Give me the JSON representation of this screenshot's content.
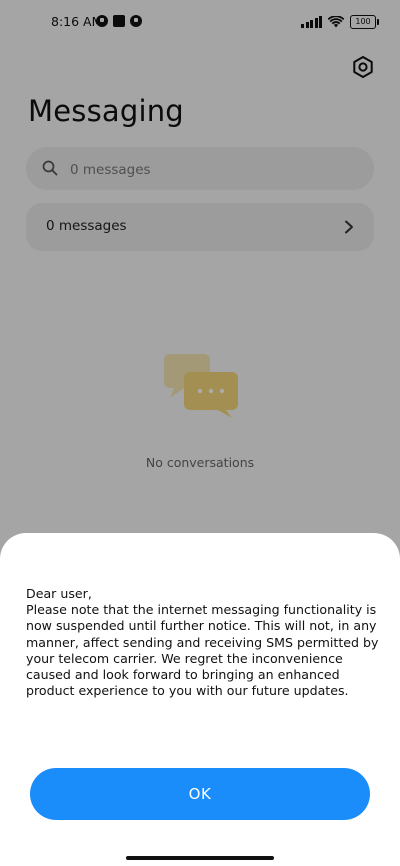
{
  "status_bar": {
    "time": "8:16 AM",
    "battery": "100"
  },
  "header": {
    "title": "Messaging"
  },
  "search": {
    "placeholder": "0 messages"
  },
  "messages_row": {
    "label": "0 messages"
  },
  "empty_state": {
    "text": "No conversations"
  },
  "notice": {
    "greeting": "Dear user,",
    "body": "Please note that the internet messaging functionality is now suspended until further notice. This will not, in any manner, affect sending and receiving SMS permitted by your telecom carrier. We regret the inconvenience caused and look forward to bringing an enhanced product experience to you with our future updates.",
    "ok_label": "OK"
  },
  "colors": {
    "accent": "#1a8dfb",
    "illustration": "#f3d67a"
  },
  "icons": {
    "settings": "gear-icon",
    "search": "search-icon",
    "chevron": "chevron-right-icon"
  }
}
